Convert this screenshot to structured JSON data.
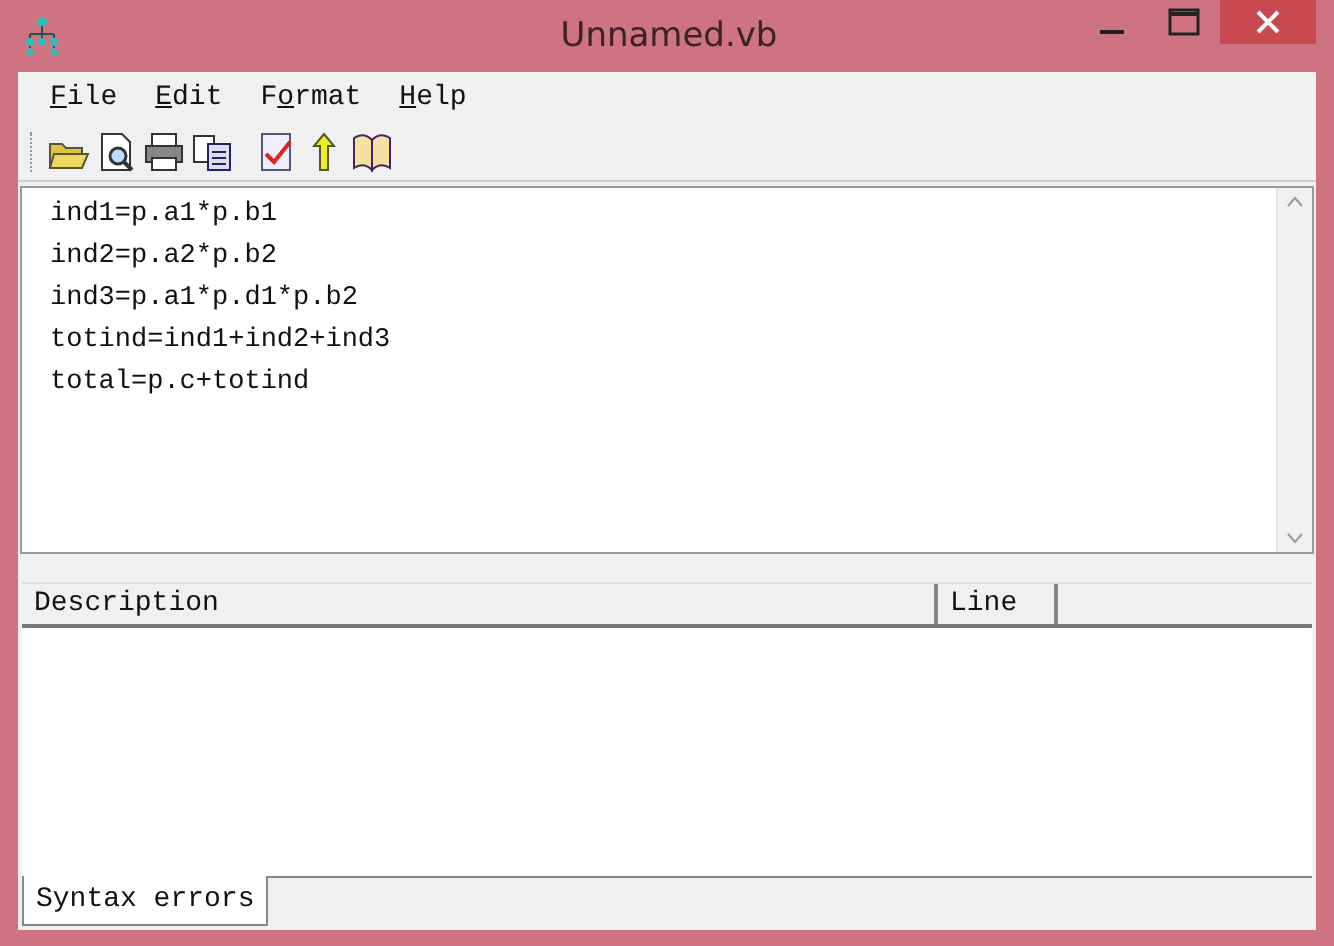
{
  "window": {
    "title": "Unnamed.vb"
  },
  "menu": [
    {
      "key": "F",
      "after": "ile"
    },
    {
      "key": "E",
      "after": "dit"
    },
    {
      "before": "F",
      "key": "o",
      "after": "rmat"
    },
    {
      "key": "H",
      "after": "elp"
    }
  ],
  "editor": {
    "lines": [
      "ind1=p.a1*p.b1",
      "ind2=p.a2*p.b2",
      "ind3=p.a1*p.d1*p.b2",
      "totind=ind1+ind2+ind3",
      "total=p.c+totind"
    ]
  },
  "errors": {
    "columns": [
      "Description",
      "Line"
    ]
  },
  "tabs": [
    {
      "label": "Syntax errors",
      "selected": true
    }
  ]
}
